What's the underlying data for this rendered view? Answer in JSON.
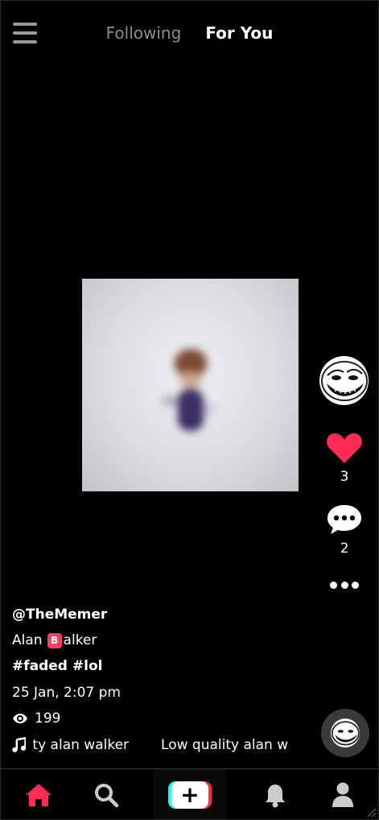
{
  "header": {
    "tabs": [
      {
        "label": "Following",
        "active": false
      },
      {
        "label": "For You",
        "active": true
      }
    ]
  },
  "post": {
    "username": "@TheMemer",
    "description_before": "Alan",
    "description_badge": "B",
    "description_after": "alker",
    "tags": [
      "#faded",
      "#lol"
    ],
    "date": "25 Jan, 2:07 pm",
    "views": "199",
    "music_text_1": "ty alan walker",
    "music_text_2": "Low quality alan wa"
  },
  "actions": {
    "likes": "3",
    "comments": "2"
  },
  "colors": {
    "accent_red": "#fe2c55",
    "accent_cyan": "#25f4ee",
    "background": "#000000"
  },
  "nav": {
    "items": [
      "home-icon",
      "search-icon",
      "add-icon",
      "bell-icon",
      "profile-icon"
    ],
    "add_label": "+"
  }
}
